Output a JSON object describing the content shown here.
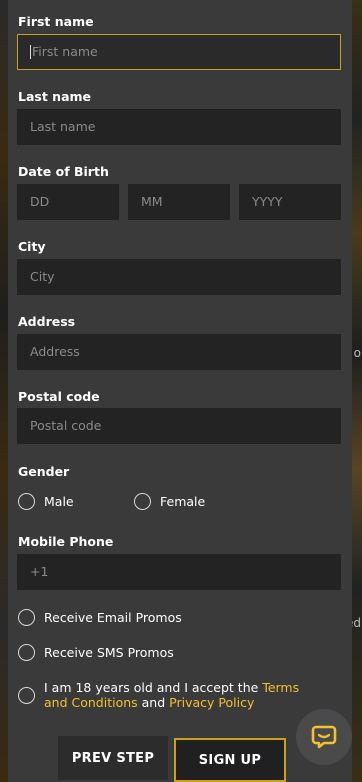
{
  "fields": {
    "first_name": {
      "label": "First name",
      "placeholder": "First name"
    },
    "last_name": {
      "label": "Last name",
      "placeholder": "Last name"
    },
    "dob": {
      "label": "Date of Birth",
      "day_placeholder": "DD",
      "month_placeholder": "MM",
      "year_placeholder": "YYYY"
    },
    "city": {
      "label": "City",
      "placeholder": "City"
    },
    "address": {
      "label": "Address",
      "placeholder": "Address"
    },
    "postal": {
      "label": "Postal code",
      "placeholder": "Postal code"
    },
    "gender": {
      "label": "Gender",
      "options": [
        "Male",
        "Female"
      ]
    },
    "phone": {
      "label": "Mobile Phone",
      "value": "+1"
    }
  },
  "checkboxes": {
    "email_promos": "Receive Email Promos",
    "sms_promos": "SMS Promos",
    "sms_prefix": "Receive",
    "terms_prefix": "I am 18 years old and I accept the",
    "terms_link": "Terms and Conditions",
    "and": "and",
    "privacy_link": "Privacy Policy"
  },
  "buttons": {
    "prev": "PREV STEP",
    "signup": "SIGN UP"
  },
  "background_fragments": {
    "right_o": "o",
    "right_ed": "ed"
  },
  "colors": {
    "accent": "#f2c12e",
    "panel": "#3a3a3a",
    "input": "#232323"
  },
  "icons": {
    "chat": "chat-bubble-icon"
  }
}
